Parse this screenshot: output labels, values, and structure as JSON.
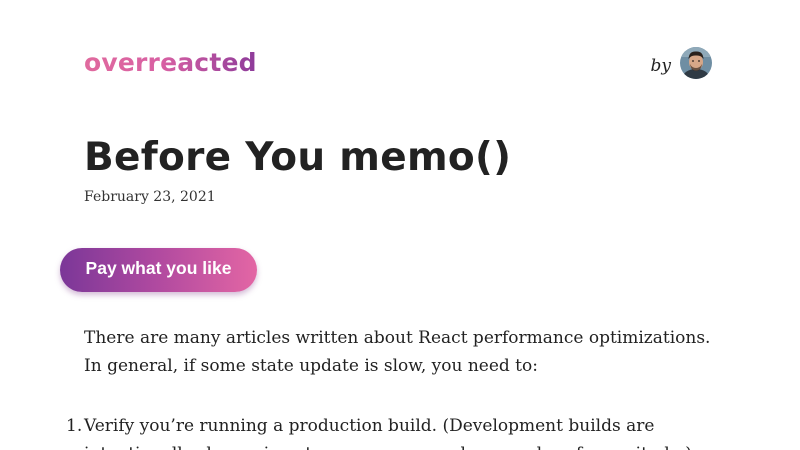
{
  "header": {
    "logo": "overreacted",
    "by_label": "by"
  },
  "post": {
    "title": "Before You memo()",
    "date": "February 23, 2021",
    "pay_button_label": "Pay what you like",
    "paragraph": "There are many articles written about React performance optimizations. In general, if some state update is slow, you need to:",
    "steps": [
      {
        "number": "1.",
        "text": "Verify you’re running a production build. (Development builds are intentionally slower, in extreme cases even by an order of magnitude.)"
      }
    ]
  },
  "icons": {
    "avatar": "author-avatar-photo"
  },
  "colors": {
    "text": "#222222",
    "logo_gradient_start": "#e06a9e",
    "logo_gradient_end": "#8d3b9a",
    "button_gradient_start": "#7b3798",
    "button_gradient_end": "#e366a4",
    "background": "#ffffff"
  }
}
